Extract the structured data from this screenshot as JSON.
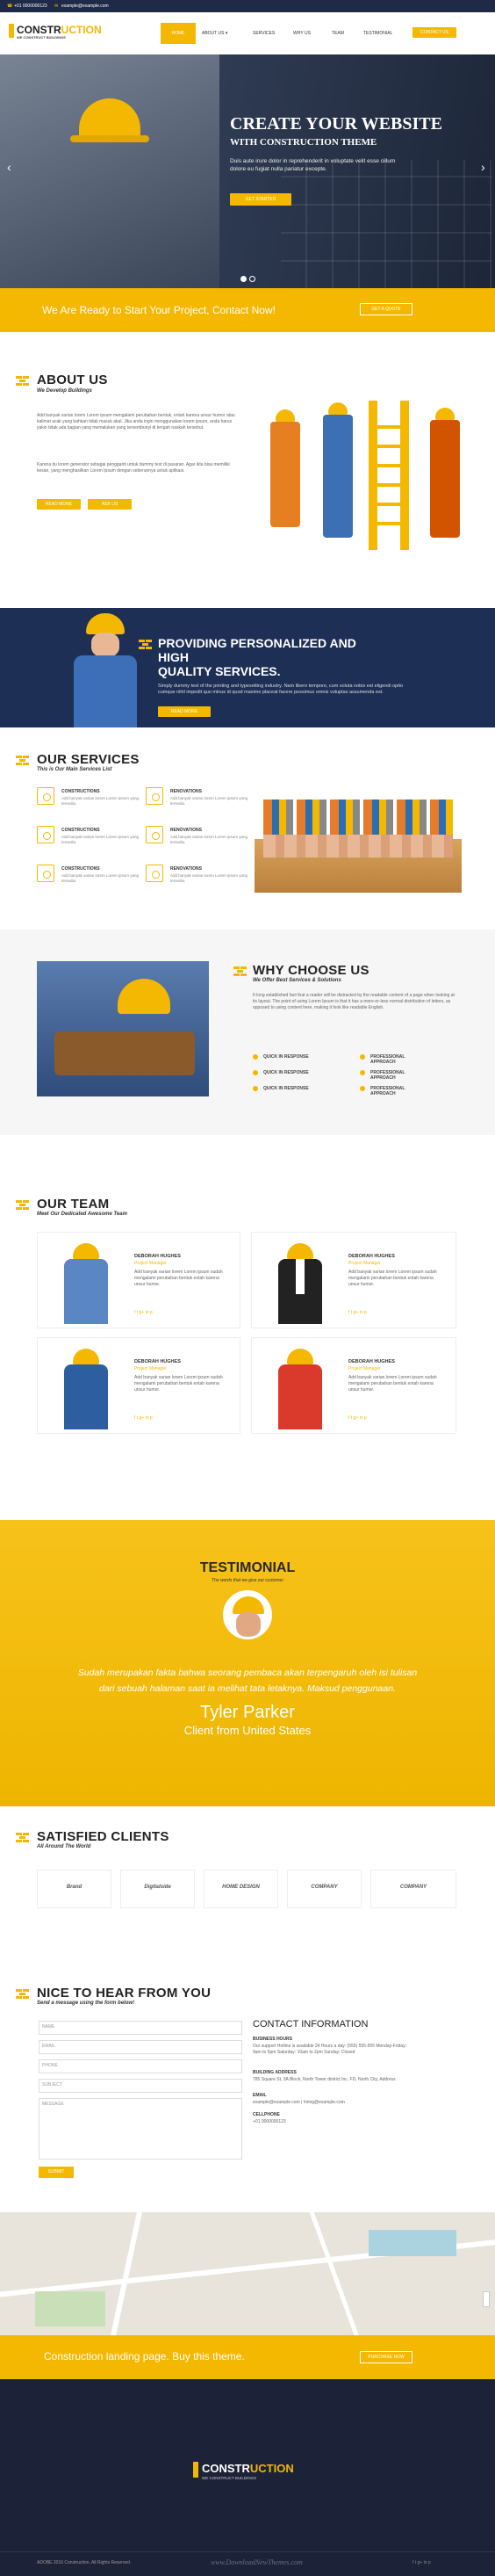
{
  "topbar": {
    "phone": "+01 0000000123",
    "email": "example@example.com"
  },
  "logo": {
    "name_a": "CONSTR",
    "name_b": "UCTION",
    "tagline": "WE CONSTRUCT BUILDINGS"
  },
  "nav": {
    "items": [
      "HOME",
      "ABOUT US",
      "SERVICES",
      "WHY US",
      "TEAM",
      "TESTIMONIAL"
    ],
    "cta": "CONTACT US"
  },
  "hero": {
    "title": "CREATE YOUR WEBSITE",
    "subtitle": "WITH CONSTRUCTION THEME",
    "text1": "Duis aute irure dolor in reprehenderit in voluptate velit esse cillum",
    "text2": "dolore eu fugiat nulla pariatur excepte.",
    "button": "GET STARTED",
    "prev": "‹",
    "next": "›"
  },
  "ready": {
    "text": "We Are Ready to Start Your Project, Contact Now!",
    "button": "GET A QUOTE"
  },
  "about": {
    "title": "ABOUT US",
    "subtitle": "We Develop Buildings",
    "p1": "Add banyak varian lorem Lorem ipsum mengalami perubahan bentuk, entah karena unsur humor atau kalimat acak yang bahkan tidak masuk akal. Jika anda ingin menggunakan lorem ipsum, anda harus yakin tidak ada bagian yang memalukan yang tersembunyi di tengah naskah tersebut.",
    "p2": "Karena itu lorem generator sebagai pengganti untuk dummy text di pasaran. Agar kita bisa memiliki kesan, yang menghasilkan Lorem Ipsum dengan sebenarnya untuk aplikasi.",
    "btn1": "READ MORE",
    "btn2": "ASK US"
  },
  "provide": {
    "line1": "PROVIDING PERSONALIZED AND",
    "line2": "HIGH",
    "line3": "QUALITY SERVICES.",
    "text": "Simply dummy text of the printing and typesetting industry. Nam libero tempore, cum soluta nobis est eligendi optio cumque nihil impedit quo minus id quod maxime placeat facere possimus omnis voluptas assumenda est.",
    "button": "READ MORE"
  },
  "services": {
    "title": "OUR SERVICES",
    "subtitle": "This is Our Main Services List",
    "items": [
      {
        "name": "CONSTRUCTIONS",
        "text": "Add banyak varian lorem Lorem ipsum yang tersedia."
      },
      {
        "name": "RENOVATIONS",
        "text": "Add banyak varian lorem Lorem ipsum yang tersedia."
      },
      {
        "name": "CONSTRUCTIONS",
        "text": "Add banyak varian lorem Lorem ipsum yang tersedia."
      },
      {
        "name": "RENOVATIONS",
        "text": "Add banyak varian lorem Lorem ipsum yang tersedia."
      },
      {
        "name": "CONSTRUCTIONS",
        "text": "Add banyak varian lorem Lorem ipsum yang tersedia."
      },
      {
        "name": "RENOVATIONS",
        "text": "Add banyak varian lorem Lorem ipsum yang tersedia."
      }
    ]
  },
  "why": {
    "title": "WHY CHOOSE US",
    "subtitle": "We Offer Best Services & Solutions",
    "text": "It long established fact that a reader will be distracted by the readable content of a page when looking at its layout. The point of using Lorem Ipsum is that it has a more-or-less normal distribution of letters, as opposed to using content here, making it look like readable English.",
    "features": [
      "QUICK IN RESPONSE",
      "PROFESSIONAL APPROACH",
      "QUICK IN RESPONSE",
      "PROFESSIONAL APPROACH",
      "QUICK IN RESPONSE",
      "PROFESSIONAL APPROACH"
    ]
  },
  "team": {
    "title": "OUR TEAM",
    "subtitle": "Meet Our Dedicated Awesome Team",
    "members": [
      {
        "name": "DEBORAH HUGHES",
        "role": "Project Manager",
        "text": "Add banyak varian lorem Lorem ipsum sudah mengalami perubahan bentuk entah karena unsur humor."
      },
      {
        "name": "DEBORAH HUGHES",
        "role": "Project Manager",
        "text": "Add banyak varian lorem Lorem ipsum sudah mengalami perubahan bentuk entah karena unsur humor."
      },
      {
        "name": "DEBORAH HUGHES",
        "role": "Project Manager",
        "text": "Add banyak varian lorem Lorem ipsum sudah mengalami perubahan bentuk entah karena unsur humor."
      },
      {
        "name": "DEBORAH HUGHES",
        "role": "Project Manager",
        "text": "Add banyak varian lorem Lorem ipsum sudah mengalami perubahan bentuk entah karena unsur humor."
      }
    ],
    "social": "f  t  g+  in  p"
  },
  "testimonial": {
    "title": "TESTIMONIAL",
    "subtitle": "The words that we give our customer",
    "quote1": "Sudah merupakan fakta bahwa seorang pembaca akan terpengaruh oleh isi tulisan",
    "quote2": "dari sebuah halaman saat ia melihat tata letaknya. Maksud penggunaan.",
    "name": "Tyler Parker",
    "origin": "Client from United States"
  },
  "clients": {
    "title": "SATISFIED CLIENTS",
    "subtitle": "All Around The World",
    "logos": [
      "Brand",
      "Digitalside",
      "HOME DESIGN",
      "COMPANY",
      "COMPANY"
    ]
  },
  "contact": {
    "title": "NICE TO HEAR FROM YOU",
    "subtitle": "Send a message using the form below!",
    "name_ph": "NAME",
    "email_ph": "EMAIL",
    "phone_ph": "PHONE",
    "subject_ph": "SUBJECT",
    "message_ph": "MESSAGE",
    "submit": "SUBMIT",
    "info_title": "CONTACT INFORMATION",
    "hours_label": "BUSINESS HOURS",
    "hours": "Our support Hotline is available 24 Hours a day: (555) 555-555 Monday-Friday: 9am to 5pm Saturday: 10am to 2pm Sunday: Closed",
    "address_label": "BUILDING ADDRESS",
    "address": "785 Square St, 3A Block, North Tower district Inc. FD, North City, Address",
    "email_label": "EMAIL",
    "email": "example@example.com | hiring@example.com",
    "cell_label": "CELLPHONE",
    "cell": "+01 0000000123"
  },
  "promo": {
    "text": "Construction landing page. Buy this theme.",
    "button": "PURCHASE NOW"
  },
  "footer": {
    "copyright": "ADOBE 2016 Construction. All Rights Reserved.",
    "watermark": "www.DownloadNewThemes.com"
  }
}
